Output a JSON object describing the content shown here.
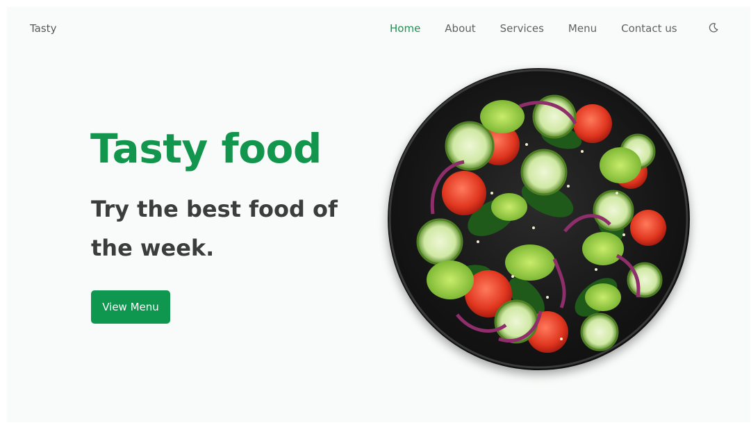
{
  "brand": {
    "name": "Tasty"
  },
  "nav": {
    "items": [
      {
        "label": "Home",
        "active": true
      },
      {
        "label": "About",
        "active": false
      },
      {
        "label": "Services",
        "active": false
      },
      {
        "label": "Menu",
        "active": false
      },
      {
        "label": "Contact us",
        "active": false
      }
    ],
    "theme_icon": "moon-icon"
  },
  "hero": {
    "title": "Tasty food",
    "subtitle": "Try the best food of the week.",
    "button_label": "View Menu",
    "image_icon": "salad-plate-image"
  },
  "colors": {
    "accent": "#12964d",
    "button": "#0f964f",
    "text_dark": "#3a3d3c",
    "nav_text": "#5d6462",
    "background": "#f9fbfa"
  }
}
